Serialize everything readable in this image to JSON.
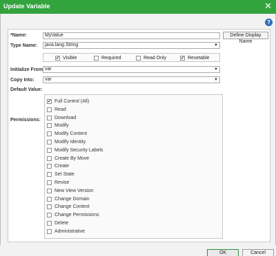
{
  "window": {
    "title": "Update Variable",
    "close_icon": "close-icon",
    "help_icon": "help-icon",
    "help_glyph": "?"
  },
  "form": {
    "name_label": "*Name:",
    "name_value": "MyValue",
    "define_display_name": "Define Display Name",
    "type_name_label": "Type Name:",
    "type_name_value": "java.lang.String",
    "checkboxes": [
      {
        "label": "Visible",
        "checked": true
      },
      {
        "label": "Required",
        "checked": false
      },
      {
        "label": "Read Only",
        "checked": false
      },
      {
        "label": "Resetable",
        "checked": true
      }
    ],
    "initialize_from_label": "Initialize From:",
    "initialize_from_value": "var",
    "copy_into_label": "Copy Into:",
    "copy_into_value": "var",
    "default_value_label": "Default Value:",
    "permissions_label": "Permissions:",
    "permissions": [
      {
        "label": "Full Control (All)",
        "checked": true
      },
      {
        "label": "Read",
        "checked": false
      },
      {
        "label": "Download",
        "checked": false
      },
      {
        "label": "Modify",
        "checked": false
      },
      {
        "label": "Modify Content",
        "checked": false
      },
      {
        "label": "Modify Identity",
        "checked": false
      },
      {
        "label": "Modify Security Labels",
        "checked": false
      },
      {
        "label": "Create By Move",
        "checked": false
      },
      {
        "label": "Create",
        "checked": false
      },
      {
        "label": "Set State",
        "checked": false
      },
      {
        "label": "Revise",
        "checked": false
      },
      {
        "label": "New View Version",
        "checked": false
      },
      {
        "label": "Change Domain",
        "checked": false
      },
      {
        "label": "Change Context",
        "checked": false
      },
      {
        "label": "Change Permissions",
        "checked": false
      },
      {
        "label": "Delete",
        "checked": false
      },
      {
        "label": "Administrative",
        "checked": false
      }
    ]
  },
  "buttons": {
    "ok": "OK",
    "cancel": "Cancel"
  },
  "colors": {
    "titlebar": "#33a33d",
    "help": "#2d6fb6"
  }
}
